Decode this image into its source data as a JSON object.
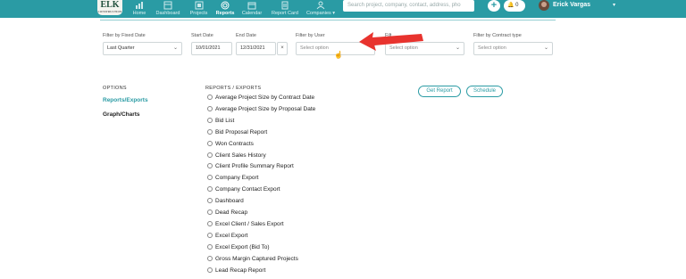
{
  "header": {
    "logo": {
      "text": "ELK",
      "subtext": "CONSTRUCTION"
    },
    "nav": [
      {
        "label": "Home",
        "icon": "home-icon"
      },
      {
        "label": "Dashboard",
        "icon": "dashboard-icon"
      },
      {
        "label": "Projects",
        "icon": "projects-icon"
      },
      {
        "label": "Reports",
        "icon": "reports-icon",
        "active": true
      },
      {
        "label": "Calendar",
        "icon": "calendar-icon"
      },
      {
        "label": "Report Card",
        "icon": "report-card-icon"
      },
      {
        "label": "Companies",
        "icon": "companies-icon"
      }
    ],
    "search_placeholder": "Search project, company, contact, address, pho",
    "plus_label": "+",
    "notification_count": "0",
    "user_name": "Erick Vargas"
  },
  "filters": {
    "fixed_date": {
      "label": "Filter by Fixed Date",
      "value": "Last Quarter"
    },
    "start_date": {
      "label": "Start Date",
      "value": "10/01/2021"
    },
    "end_date": {
      "label": "End Date",
      "value": "12/31/2021"
    },
    "clear_label": "×",
    "user": {
      "label": "Filter by User",
      "placeholder": "Select option"
    },
    "hidden_filter": {
      "label": "Filt",
      "placeholder": "Select option"
    },
    "contract_type": {
      "label": "Filter by Contract type",
      "placeholder": "Select option"
    }
  },
  "options": {
    "heading": "OPTIONS",
    "items": [
      "Reports/Exports",
      "Graph/Charts"
    ]
  },
  "reports": {
    "heading": "REPORTS / EXPORTS",
    "items": [
      "Average Project Size by Contract Date",
      "Average Project Size by Proposal Date",
      "Bid List",
      "Bid Proposal Report",
      "Won Contracts",
      "Client Sales History",
      "Client Profile Summary Report",
      "Company Export",
      "Company Contact Export",
      "Dashboard",
      "Dead Recap",
      "Excel Client / Sales Export",
      "Excel Export",
      "Excel Export (Bid To)",
      "Gross Margin Captured Projects",
      "Lead Recap Report"
    ]
  },
  "actions": {
    "get_report": "Get Report",
    "schedule": "Schedule"
  },
  "colors": {
    "brand": "#2a9ba4",
    "annotation_arrow": "#e8332e"
  }
}
